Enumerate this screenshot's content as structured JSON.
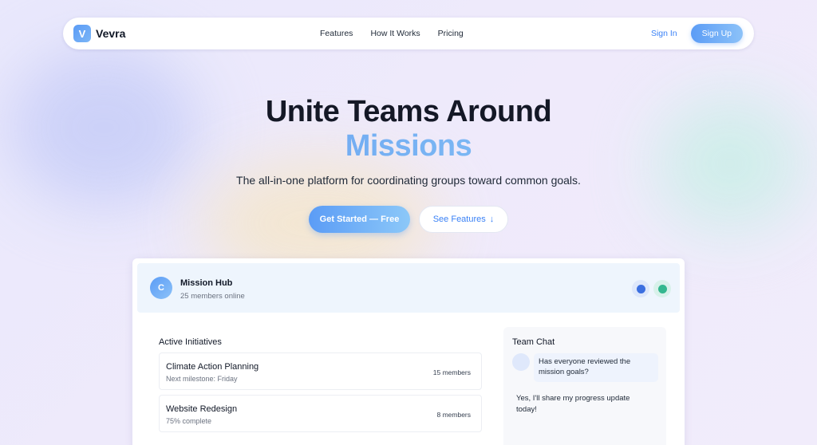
{
  "brand": {
    "logo_letter": "V",
    "name": "Vevra"
  },
  "nav": {
    "links": [
      "Features",
      "How It Works",
      "Pricing"
    ],
    "sign_in": "Sign In",
    "sign_up": "Sign Up"
  },
  "hero": {
    "title_line1": "Unite Teams Around",
    "title_accent": "Missions",
    "subtitle": "The all-in-one platform for coordinating groups toward common goals.",
    "cta_primary": "Get Started — Free",
    "cta_secondary": "See Features",
    "cta_secondary_icon": "↓"
  },
  "hub": {
    "avatar_letter": "C",
    "title": "Mission Hub",
    "subtitle": "25 members online",
    "status_dots": [
      {
        "icon": "presence-dot-icon",
        "color": "#3b6fe0"
      },
      {
        "icon": "presence-dot-icon",
        "color": "#34b78f"
      }
    ]
  },
  "initiatives": {
    "title": "Active Initiatives",
    "items": [
      {
        "name": "Climate Action Planning",
        "detail": "Next milestone: Friday",
        "members": "15 members"
      },
      {
        "name": "Website Redesign",
        "detail": "75% complete",
        "members": "8 members"
      }
    ]
  },
  "chat": {
    "title": "Team Chat",
    "messages": [
      {
        "text": "Has everyone reviewed the mission goals?"
      },
      {
        "text": "Yes, I'll share my progress update today!"
      }
    ]
  },
  "colors": {
    "accent": "#3b82f6",
    "accent_light": "#8cc2f8",
    "text": "#111827",
    "muted": "#6b7280"
  }
}
